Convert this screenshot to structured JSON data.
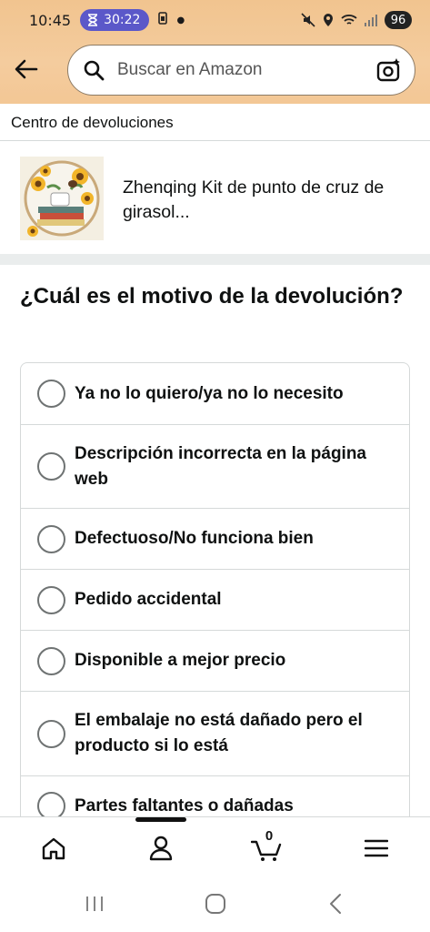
{
  "status_bar": {
    "time": "10:45",
    "timer": "30:22",
    "battery": "96",
    "icons": [
      "timer-icon",
      "sim-icon",
      "mute-icon",
      "location-icon",
      "wifi-icon",
      "signal-icon"
    ]
  },
  "header": {
    "back_icon": "arrow-left-icon",
    "search_placeholder": "Buscar en Amazon",
    "camera_icon": "camera-sparkle-icon"
  },
  "breadcrumb": "Centro de devoluciones",
  "product": {
    "title": "Zhenqing Kit de punto de cruz de girasol..."
  },
  "question": "¿Cuál es el motivo de la devolución?",
  "options": [
    {
      "label": "Ya no lo quiero/ya no lo necesito",
      "selected": false
    },
    {
      "label": "Descripción incorrecta en la página web",
      "selected": false
    },
    {
      "label": "Defectuoso/No funciona bien",
      "selected": false
    },
    {
      "label": "Pedido accidental",
      "selected": false
    },
    {
      "label": "Disponible a mejor precio",
      "selected": false
    },
    {
      "label": "El embalaje no está dañado pero el producto si lo está",
      "selected": false
    },
    {
      "label": "Partes faltantes o dañadas",
      "selected": false
    }
  ],
  "bottom_nav": {
    "items": [
      "home-icon",
      "account-icon",
      "cart-icon",
      "menu-icon"
    ],
    "cart_count": "0"
  },
  "system_nav": [
    "recents-icon",
    "home-circle-icon",
    "back-chevron-icon"
  ],
  "colors": {
    "header_top": "#f1c48f",
    "header_bottom": "#f3c795",
    "timer_pill": "#5b58c9",
    "text": "#0f1111",
    "border": "#d5d9d9"
  }
}
